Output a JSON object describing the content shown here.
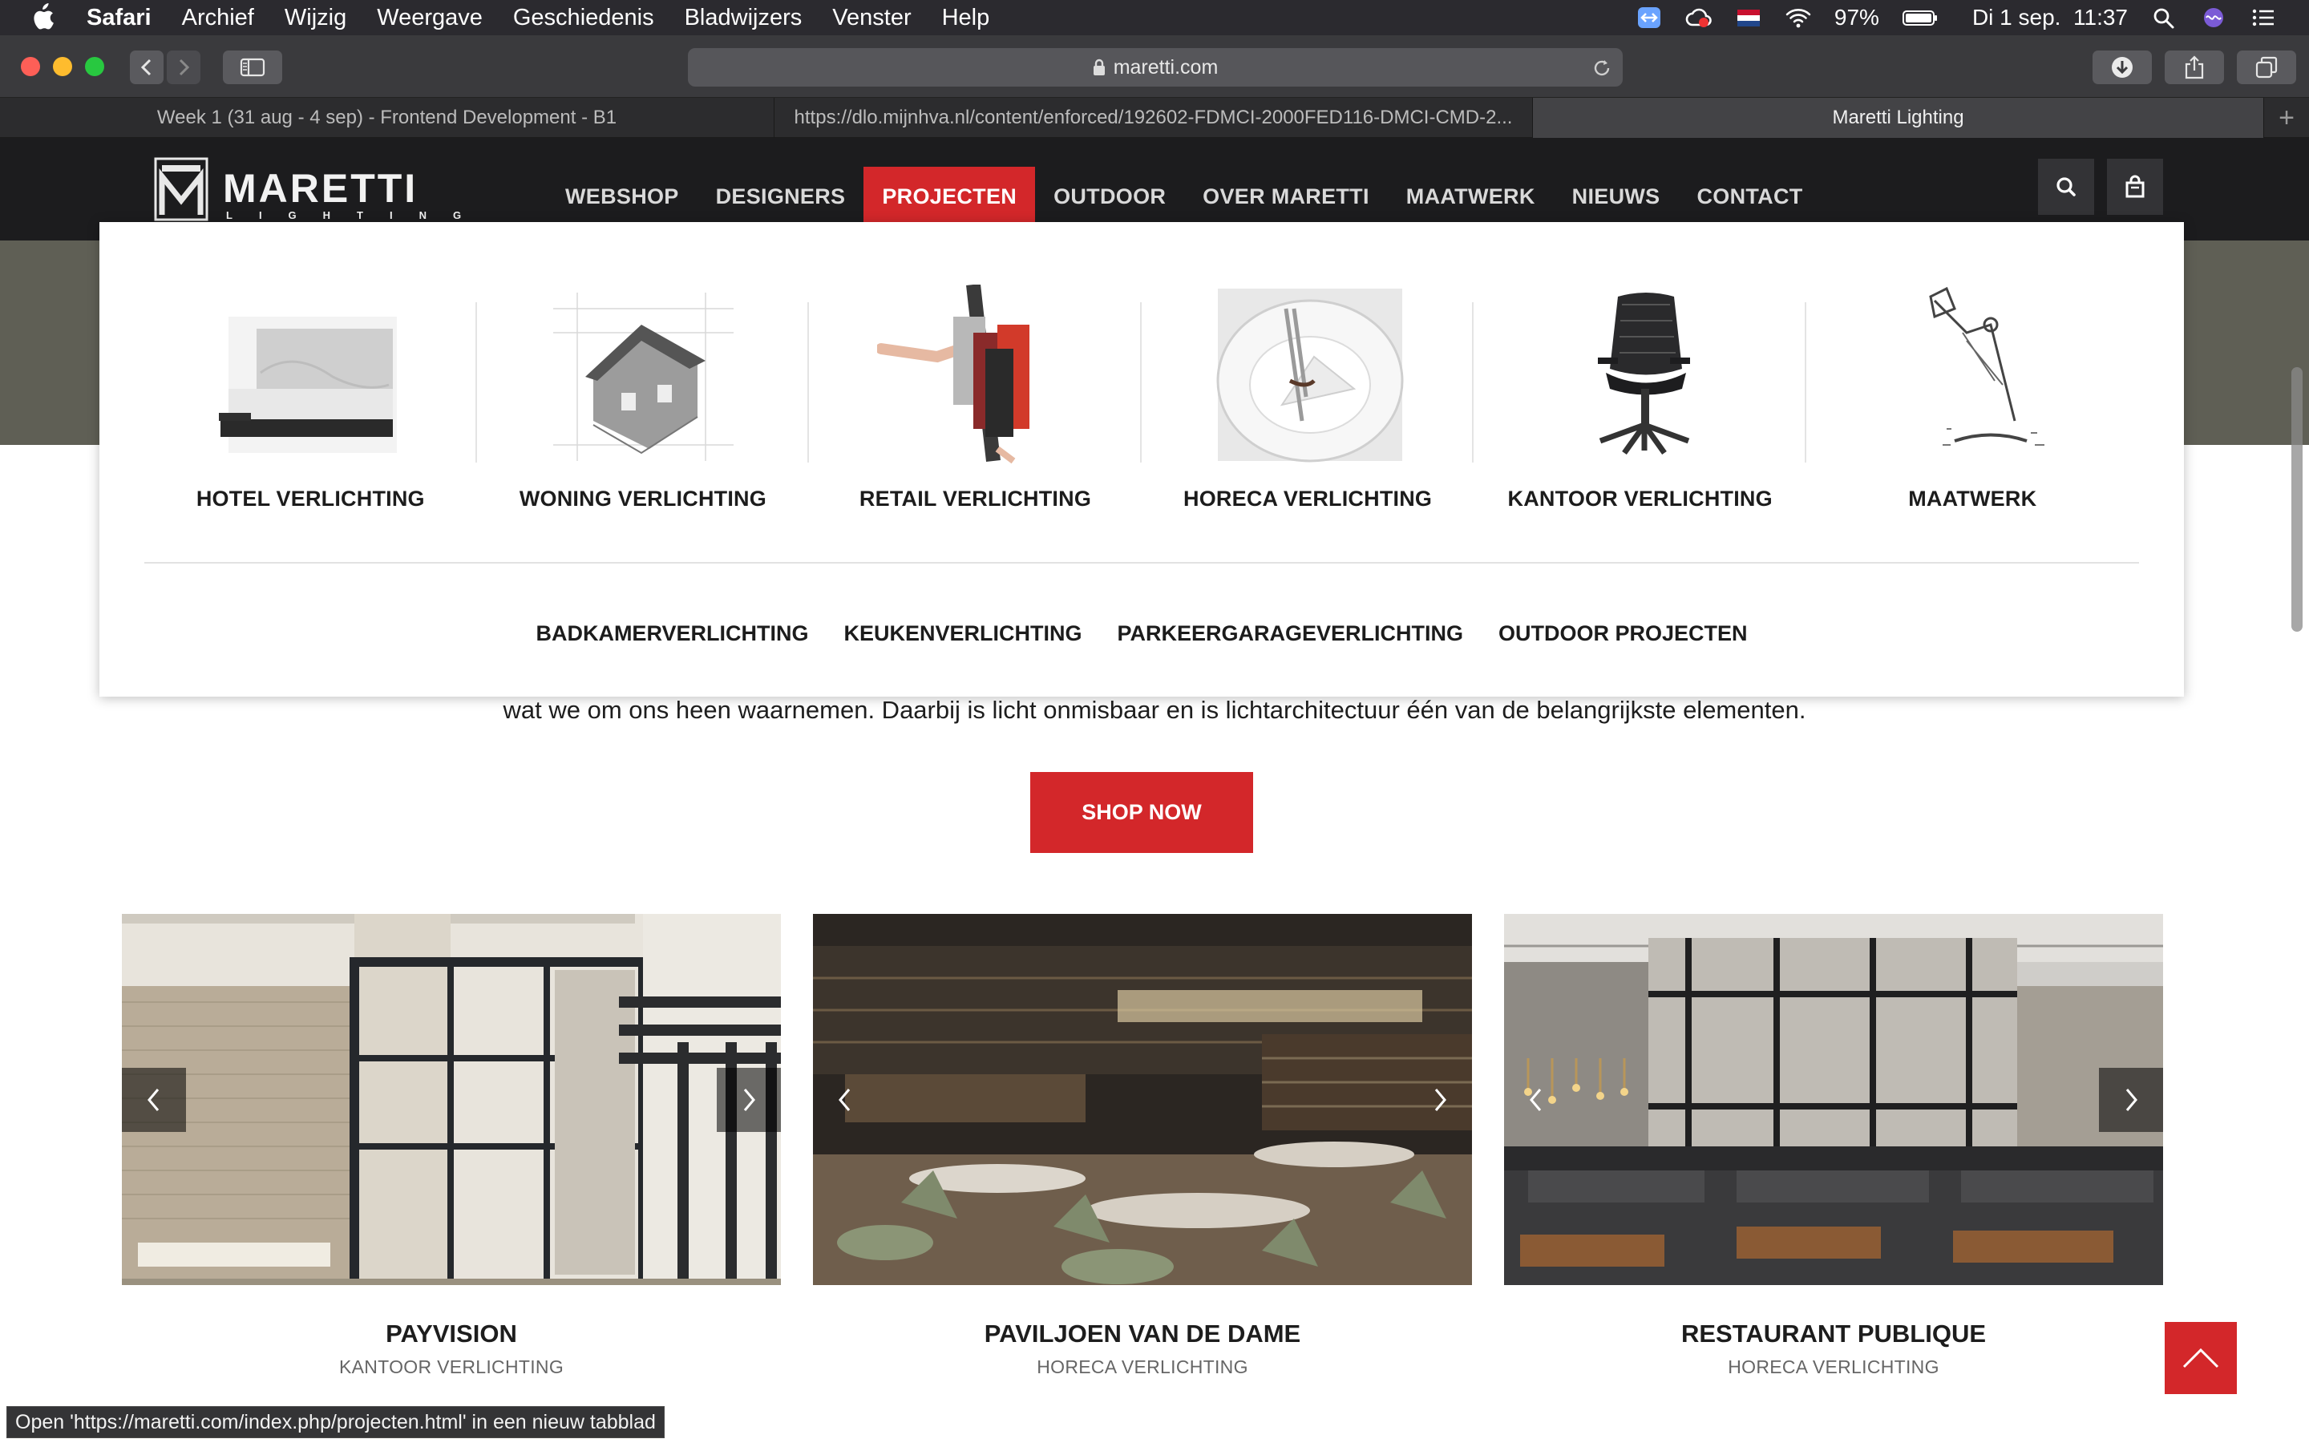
{
  "os": {
    "menu": [
      "Safari",
      "Archief",
      "Wijzig",
      "Weergave",
      "Geschiedenis",
      "Bladwijzers",
      "Venster",
      "Help"
    ],
    "battery": "97%",
    "clock": "Di 1 sep.  11:37"
  },
  "browser": {
    "url": "maretti.com",
    "tabs": [
      "Week 1 (31 aug - 4 sep) - Frontend Development - B1",
      "https://dlo.mijnhva.nl/content/enforced/192602-FDMCI-2000FED116-DMCI-CMD-2...",
      "Maretti Lighting"
    ],
    "status_text": "Open 'https://maretti.com/index.php/projecten.html' in een nieuw tabblad"
  },
  "site": {
    "logo_text": "MARETTI",
    "logo_sub": "LIGHTING",
    "nav": [
      "WEBSHOP",
      "DESIGNERS",
      "PROJECTEN",
      "OUTDOOR",
      "OVER MARETTI",
      "MAATWERK",
      "NIEUWS",
      "CONTACT"
    ],
    "active_nav": "PROJECTEN",
    "accent_color": "#d3272a",
    "mega": {
      "categories": [
        "HOTEL VERLICHTING",
        "WONING VERLICHTING",
        "RETAIL VERLICHTING",
        "HORECA VERLICHTING",
        "KANTOOR VERLICHTING",
        "MAATWERK"
      ],
      "sublinks": [
        "BADKAMERVERLICHTING",
        "KEUKENVERLICHTING",
        "PARKEERGARAGEVERLICHTING",
        "OUTDOOR PROJECTEN"
      ]
    },
    "intro": "wat we om ons heen waarnemen. Daarbij is licht onmisbaar en is lichtarchitectuur één van de belangrijkste elementen.",
    "shop_label": "SHOP NOW",
    "projects": [
      {
        "title": "PAYVISION",
        "category": "KANTOOR VERLICHTING"
      },
      {
        "title": "PAVILJOEN VAN DE DAME",
        "category": "HORECA VERLICHTING"
      },
      {
        "title": "RESTAURANT PUBLIQUE",
        "category": "HORECA VERLICHTING"
      }
    ]
  }
}
